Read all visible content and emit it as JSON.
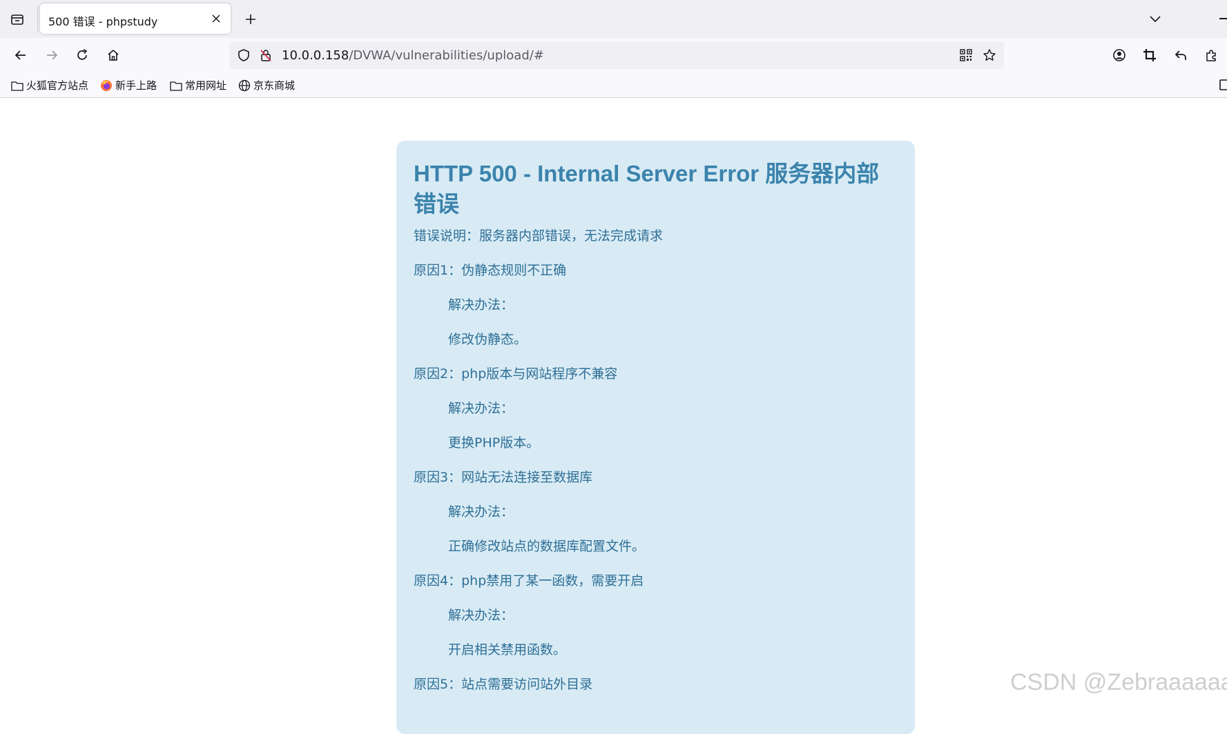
{
  "tab": {
    "title": "500 错误 - phpstudy"
  },
  "url": {
    "host": "10.0.0.158",
    "path": "/DVWA/vulnerabilities/upload/#"
  },
  "bookmarks": [
    {
      "label": "火狐官方站点",
      "icon": "folder-icon"
    },
    {
      "label": "新手上路",
      "icon": "firefox-icon"
    },
    {
      "label": "常用网址",
      "icon": "folder-icon"
    },
    {
      "label": "京东商城",
      "icon": "globe-icon"
    }
  ],
  "page": {
    "title": "HTTP 500 - Internal Server Error 服务器内部错误",
    "description": "错误说明：服务器内部错误，无法完成请求",
    "reasons": [
      {
        "reason": "原因1：伪静态规则不正确",
        "solution_label": "解决办法：",
        "solution": "修改伪静态。"
      },
      {
        "reason": "原因2：php版本与网站程序不兼容",
        "solution_label": "解决办法：",
        "solution": "更换PHP版本。"
      },
      {
        "reason": "原因3：网站无法连接至数据库",
        "solution_label": "解决办法：",
        "solution": "正确修改站点的数据库配置文件。"
      },
      {
        "reason": "原因4：php禁用了某一函数，需要开启",
        "solution_label": "解决办法：",
        "solution": "开启相关禁用函数。"
      },
      {
        "reason": "原因5：站点需要访问站外目录"
      }
    ]
  },
  "watermark": "CSDN @Zebraaaaaa",
  "colors": {
    "error_box_bg": "#d8ebf5",
    "error_title": "#3b83ac",
    "error_text": "#2f6f96"
  }
}
